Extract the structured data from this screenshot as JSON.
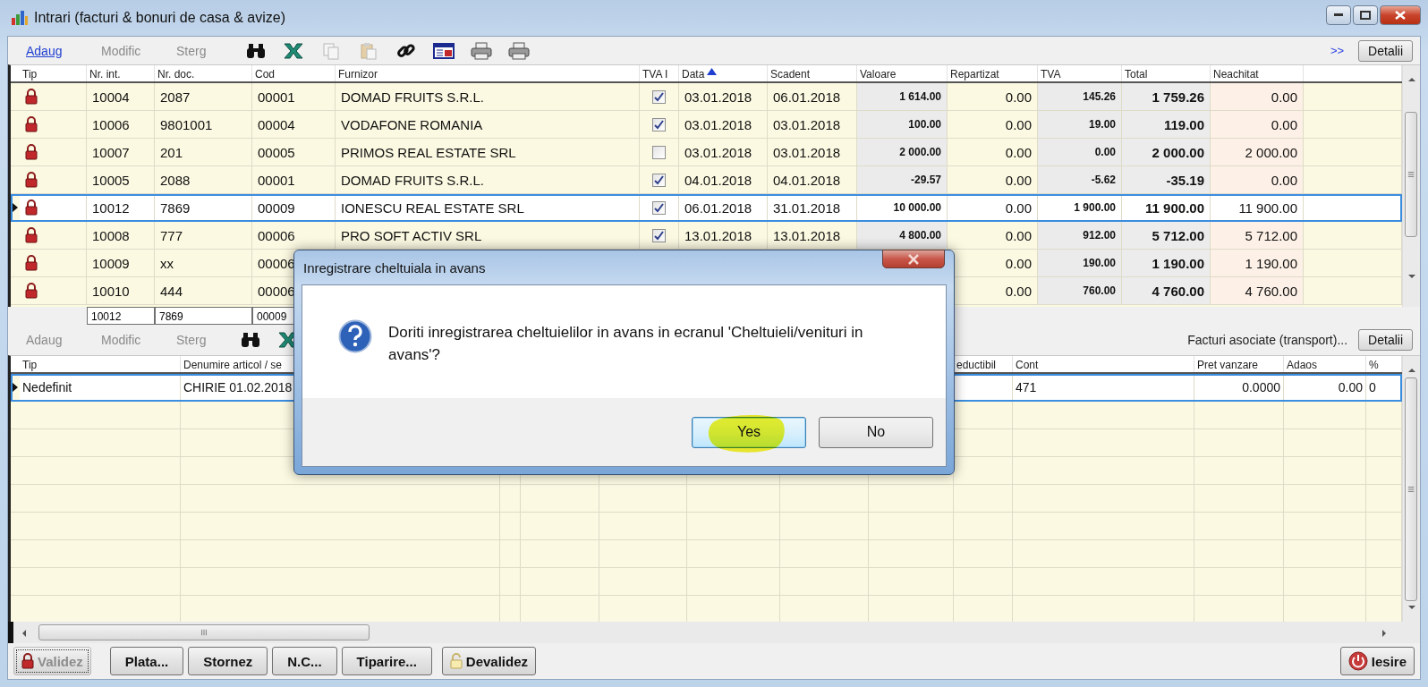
{
  "window": {
    "title": "Intrari (facturi & bonuri de casa & avize)"
  },
  "toolbar": {
    "actions": [
      {
        "label": "Adaug",
        "disabled": false
      },
      {
        "label": "Modific",
        "disabled": true
      },
      {
        "label": "Sterg",
        "disabled": true
      }
    ],
    "tools": [
      {
        "disabled": false
      },
      {
        "disabled": false
      },
      {
        "disabled": true
      },
      {
        "disabled": true
      },
      {
        "disabled": false
      },
      {
        "disabled": false
      },
      {
        "disabled": false
      },
      {
        "disabled": false
      }
    ],
    "more": ">>",
    "details_button": "Detalii"
  },
  "top_table": {
    "columns": [
      {
        "label": "Tip"
      },
      {
        "label": "Nr. int."
      },
      {
        "label": "Nr. doc."
      },
      {
        "label": "Cod"
      },
      {
        "label": "Furnizor"
      },
      {
        "label": "TVA I"
      },
      {
        "label": "Data",
        "sorted_ascending": true
      },
      {
        "label": "Scadent"
      },
      {
        "label": "Valoare"
      },
      {
        "label": "Repartizat"
      },
      {
        "label": "TVA"
      },
      {
        "label": "Total"
      },
      {
        "label": "Neachitat"
      }
    ],
    "rows": [
      {
        "selected": false,
        "locked": true,
        "nr_int": "10004",
        "nr_doc": "2087",
        "cod": "00001",
        "furnizor": "DOMAD FRUITS S.R.L.",
        "tva_i": true,
        "data": "03.01.2018",
        "scadent": "06.01.2018",
        "valoare": "1 614.00",
        "repartizat": "0.00",
        "tva": "145.26",
        "total": "1 759.26",
        "neachitat": "0.00"
      },
      {
        "selected": false,
        "locked": true,
        "nr_int": "10006",
        "nr_doc": "9801001",
        "cod": "00004",
        "furnizor": "VODAFONE ROMANIA",
        "tva_i": true,
        "data": "03.01.2018",
        "scadent": "03.01.2018",
        "valoare": "100.00",
        "repartizat": "0.00",
        "tva": "19.00",
        "total": "119.00",
        "neachitat": "0.00"
      },
      {
        "selected": false,
        "locked": true,
        "nr_int": "10007",
        "nr_doc": "201",
        "cod": "00005",
        "furnizor": "PRIMOS REAL ESTATE SRL",
        "tva_i": false,
        "data": "03.01.2018",
        "scadent": "03.01.2018",
        "valoare": "2 000.00",
        "repartizat": "0.00",
        "tva": "0.00",
        "total": "2 000.00",
        "neachitat": "2 000.00"
      },
      {
        "selected": false,
        "locked": true,
        "nr_int": "10005",
        "nr_doc": "2088",
        "cod": "00001",
        "furnizor": "DOMAD FRUITS S.R.L.",
        "tva_i": true,
        "data": "04.01.2018",
        "scadent": "04.01.2018",
        "valoare": "-29.57",
        "repartizat": "0.00",
        "tva": "-5.62",
        "total": "-35.19",
        "neachitat": "0.00"
      },
      {
        "selected": true,
        "locked": true,
        "nr_int": "10012",
        "nr_doc": "7869",
        "cod": "00009",
        "furnizor": "IONESCU REAL ESTATE SRL",
        "tva_i": true,
        "data": "06.01.2018",
        "scadent": "31.01.2018",
        "valoare": "10 000.00",
        "repartizat": "0.00",
        "tva": "1 900.00",
        "total": "11 900.00",
        "neachitat": "11 900.00"
      },
      {
        "selected": false,
        "locked": true,
        "nr_int": "10008",
        "nr_doc": "777",
        "cod": "00006",
        "furnizor": "PRO SOFT ACTIV SRL",
        "tva_i": true,
        "data": "13.01.2018",
        "scadent": "13.01.2018",
        "valoare": "4 800.00",
        "repartizat": "0.00",
        "tva": "912.00",
        "total": "5 712.00",
        "neachitat": "5 712.00"
      },
      {
        "selected": false,
        "locked": true,
        "nr_int": "10009",
        "nr_doc": "xx",
        "cod": "00006",
        "repartizat": "0.00",
        "tva": "190.00",
        "total": "1 190.00",
        "neachitat": "1 190.00"
      },
      {
        "selected": false,
        "locked": true,
        "nr_int": "10010",
        "nr_doc": "444",
        "cod": "00006",
        "repartizat": "0.00",
        "tva": "760.00",
        "total": "4 760.00",
        "neachitat": "4 760.00"
      }
    ],
    "footer": [
      "10012",
      "7869",
      "00009"
    ]
  },
  "detail_toolbar": {
    "actions": [
      {
        "label": "Adaug",
        "disabled": true
      },
      {
        "label": "Modific",
        "disabled": true
      },
      {
        "label": "Sterg",
        "disabled": true
      }
    ],
    "link": "Facturi asociate (transport)...",
    "details_button": "Detalii"
  },
  "detail_table": {
    "columns": [
      {
        "label": "Tip"
      },
      {
        "label": "Denumire articol / se"
      },
      {
        "label": "eductibil"
      },
      {
        "label": "Cont"
      },
      {
        "label": "Pret vanzare"
      },
      {
        "label": "Adaos"
      },
      {
        "label": "%"
      }
    ],
    "rows": [
      {
        "selected": true,
        "cells": [
          "Nedefinit",
          "CHIRIE 01.02.2018",
          null,
          "471",
          "0.0000",
          "0.00",
          "0"
        ]
      }
    ]
  },
  "buttons": [
    {
      "label": "Validez",
      "kind": "locked",
      "disabled": true
    },
    {
      "label": "Plata...",
      "kind": "plain",
      "disabled": false
    },
    {
      "label": "Stornez",
      "kind": "plain",
      "disabled": false
    },
    {
      "label": "N.C...",
      "kind": "plain",
      "disabled": false
    },
    {
      "label": "Tiparire...",
      "kind": "plain",
      "disabled": false
    },
    {
      "label": "Devalidez",
      "kind": "unlocked",
      "disabled": false
    }
  ],
  "exit_button": "Iesire",
  "dialog": {
    "title": "Inregistrare cheltuiala in avans",
    "message": "Doriti inregistrarea cheltuielilor in avans in ecranul 'Cheltuieli/venituri in avans'?",
    "buttons": [
      {
        "label": "Yes",
        "selected": true
      },
      {
        "label": "No",
        "selected": false
      }
    ]
  }
}
